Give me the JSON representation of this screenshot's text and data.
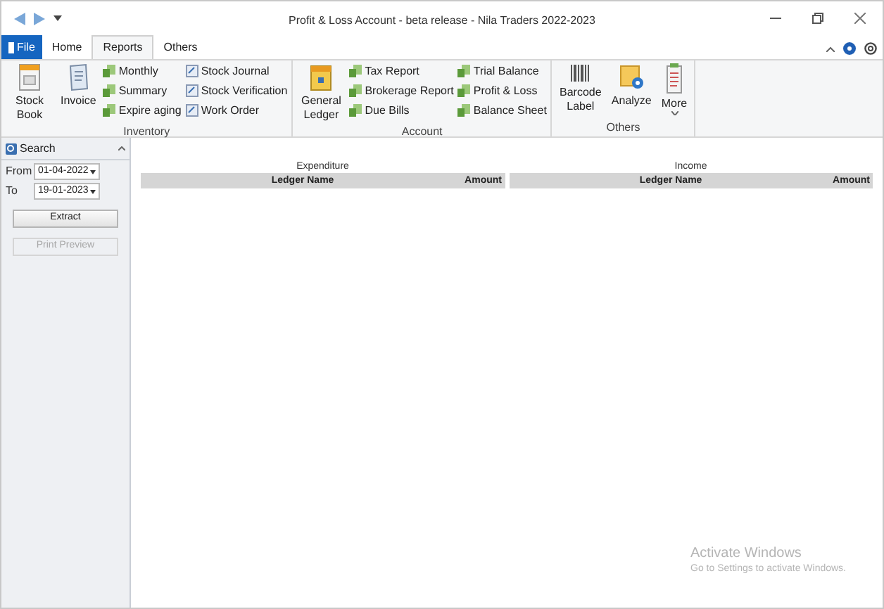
{
  "window": {
    "title": "Profit & Loss Account - beta release - Nila Traders 2022-2023"
  },
  "tabs": [
    {
      "label": "File",
      "kind": "file",
      "selected": false
    },
    {
      "label": "Home",
      "kind": "tab",
      "selected": false
    },
    {
      "label": "Reports",
      "kind": "tab",
      "selected": true
    },
    {
      "label": "Others",
      "kind": "tab",
      "selected": false
    }
  ],
  "ribbon": {
    "groups": [
      {
        "title": "Inventory",
        "items": [
          {
            "kind": "large",
            "label": "Stock Book"
          },
          {
            "kind": "large",
            "label": "Invoice"
          },
          {
            "kind": "stack",
            "items": [
              {
                "kind": "report",
                "label": "Monthly"
              },
              {
                "kind": "report",
                "label": "Summary"
              },
              {
                "kind": "report",
                "label": "Expire aging"
              }
            ]
          },
          {
            "kind": "stack",
            "items": [
              {
                "kind": "journal",
                "label": "Stock Journal"
              },
              {
                "kind": "journal",
                "label": "Stock Verification"
              },
              {
                "kind": "journal",
                "label": "Work Order"
              }
            ]
          }
        ]
      },
      {
        "title": "Account",
        "items": [
          {
            "kind": "large",
            "label": "General Ledger"
          },
          {
            "kind": "stack",
            "items": [
              {
                "kind": "report",
                "label": "Tax Report"
              },
              {
                "kind": "report",
                "label": "Brokerage Report"
              },
              {
                "kind": "report",
                "label": "Due Bills"
              }
            ]
          },
          {
            "kind": "stack",
            "items": [
              {
                "kind": "report",
                "label": "Trial Balance"
              },
              {
                "kind": "report",
                "label": "Profit & Loss"
              },
              {
                "kind": "report",
                "label": "Balance Sheet"
              }
            ]
          }
        ]
      },
      {
        "title": "Others",
        "items": [
          {
            "kind": "large",
            "label": "Barcode Label"
          },
          {
            "kind": "large",
            "label": "Analyze"
          },
          {
            "kind": "large",
            "label": "More",
            "dropdown": true
          }
        ]
      }
    ]
  },
  "sidebar": {
    "title": "Search",
    "from": {
      "label": "From",
      "value": "01-04-2022"
    },
    "to": {
      "label": "To",
      "value": "19-01-2023"
    },
    "buttons": [
      {
        "label": "Extract",
        "disabled": false
      },
      {
        "label": "Print Preview",
        "disabled": true
      }
    ]
  },
  "tables": [
    {
      "title": "Expenditure",
      "columns": [
        "Ledger Name",
        "Amount"
      ]
    },
    {
      "title": "Income",
      "columns": [
        "Ledger Name",
        "Amount"
      ]
    }
  ],
  "overlay": {
    "title": "Activate Windows",
    "subtitle": "Go to Settings to activate Windows."
  }
}
